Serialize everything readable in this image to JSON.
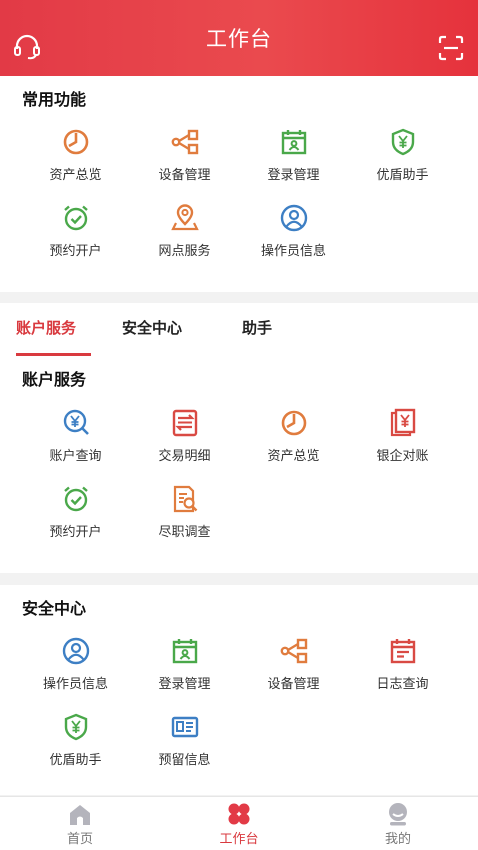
{
  "header": {
    "title": "工作台"
  },
  "common": {
    "title": "常用功能",
    "items": [
      {
        "label": "资产总览",
        "icon": "pie-chart-icon"
      },
      {
        "label": "设备管理",
        "icon": "share-nodes-icon"
      },
      {
        "label": "登录管理",
        "icon": "login-calendar-icon"
      },
      {
        "label": "优盾助手",
        "icon": "shield-yuan-icon"
      },
      {
        "label": "预约开户",
        "icon": "alarm-clock-icon"
      },
      {
        "label": "网点服务",
        "icon": "map-pin-icon"
      },
      {
        "label": "操作员信息",
        "icon": "user-circle-icon"
      }
    ]
  },
  "tabs": [
    {
      "label": "账户服务",
      "active": true
    },
    {
      "label": "安全中心",
      "active": false
    },
    {
      "label": "助手",
      "active": false
    }
  ],
  "account": {
    "title": "账户服务",
    "items": [
      {
        "label": "账户查询",
        "icon": "yuan-search-icon"
      },
      {
        "label": "交易明细",
        "icon": "transaction-list-icon"
      },
      {
        "label": "资产总览",
        "icon": "pie-chart-icon"
      },
      {
        "label": "银企对账",
        "icon": "yuan-document-icon"
      },
      {
        "label": "预约开户",
        "icon": "alarm-clock-icon"
      },
      {
        "label": "尽职调查",
        "icon": "document-search-icon"
      }
    ]
  },
  "security": {
    "title": "安全中心",
    "items": [
      {
        "label": "操作员信息",
        "icon": "user-circle-icon"
      },
      {
        "label": "登录管理",
        "icon": "login-calendar-icon"
      },
      {
        "label": "设备管理",
        "icon": "share-nodes-icon"
      },
      {
        "label": "日志查询",
        "icon": "log-calendar-icon"
      },
      {
        "label": "优盾助手",
        "icon": "shield-yuan-icon"
      },
      {
        "label": "预留信息",
        "icon": "id-card-icon"
      }
    ]
  },
  "tabbar": {
    "items": [
      {
        "label": "首页",
        "icon": "home-icon",
        "active": false
      },
      {
        "label": "工作台",
        "icon": "clover-icon",
        "active": true
      },
      {
        "label": "我的",
        "icon": "profile-icon",
        "active": false
      }
    ]
  },
  "colors": {
    "brand": "#e23a46",
    "orange": "#e07c3e",
    "green": "#4aa84a",
    "blue": "#3d7fc4",
    "red": "#d94a43",
    "gray": "#b4b4bc"
  }
}
